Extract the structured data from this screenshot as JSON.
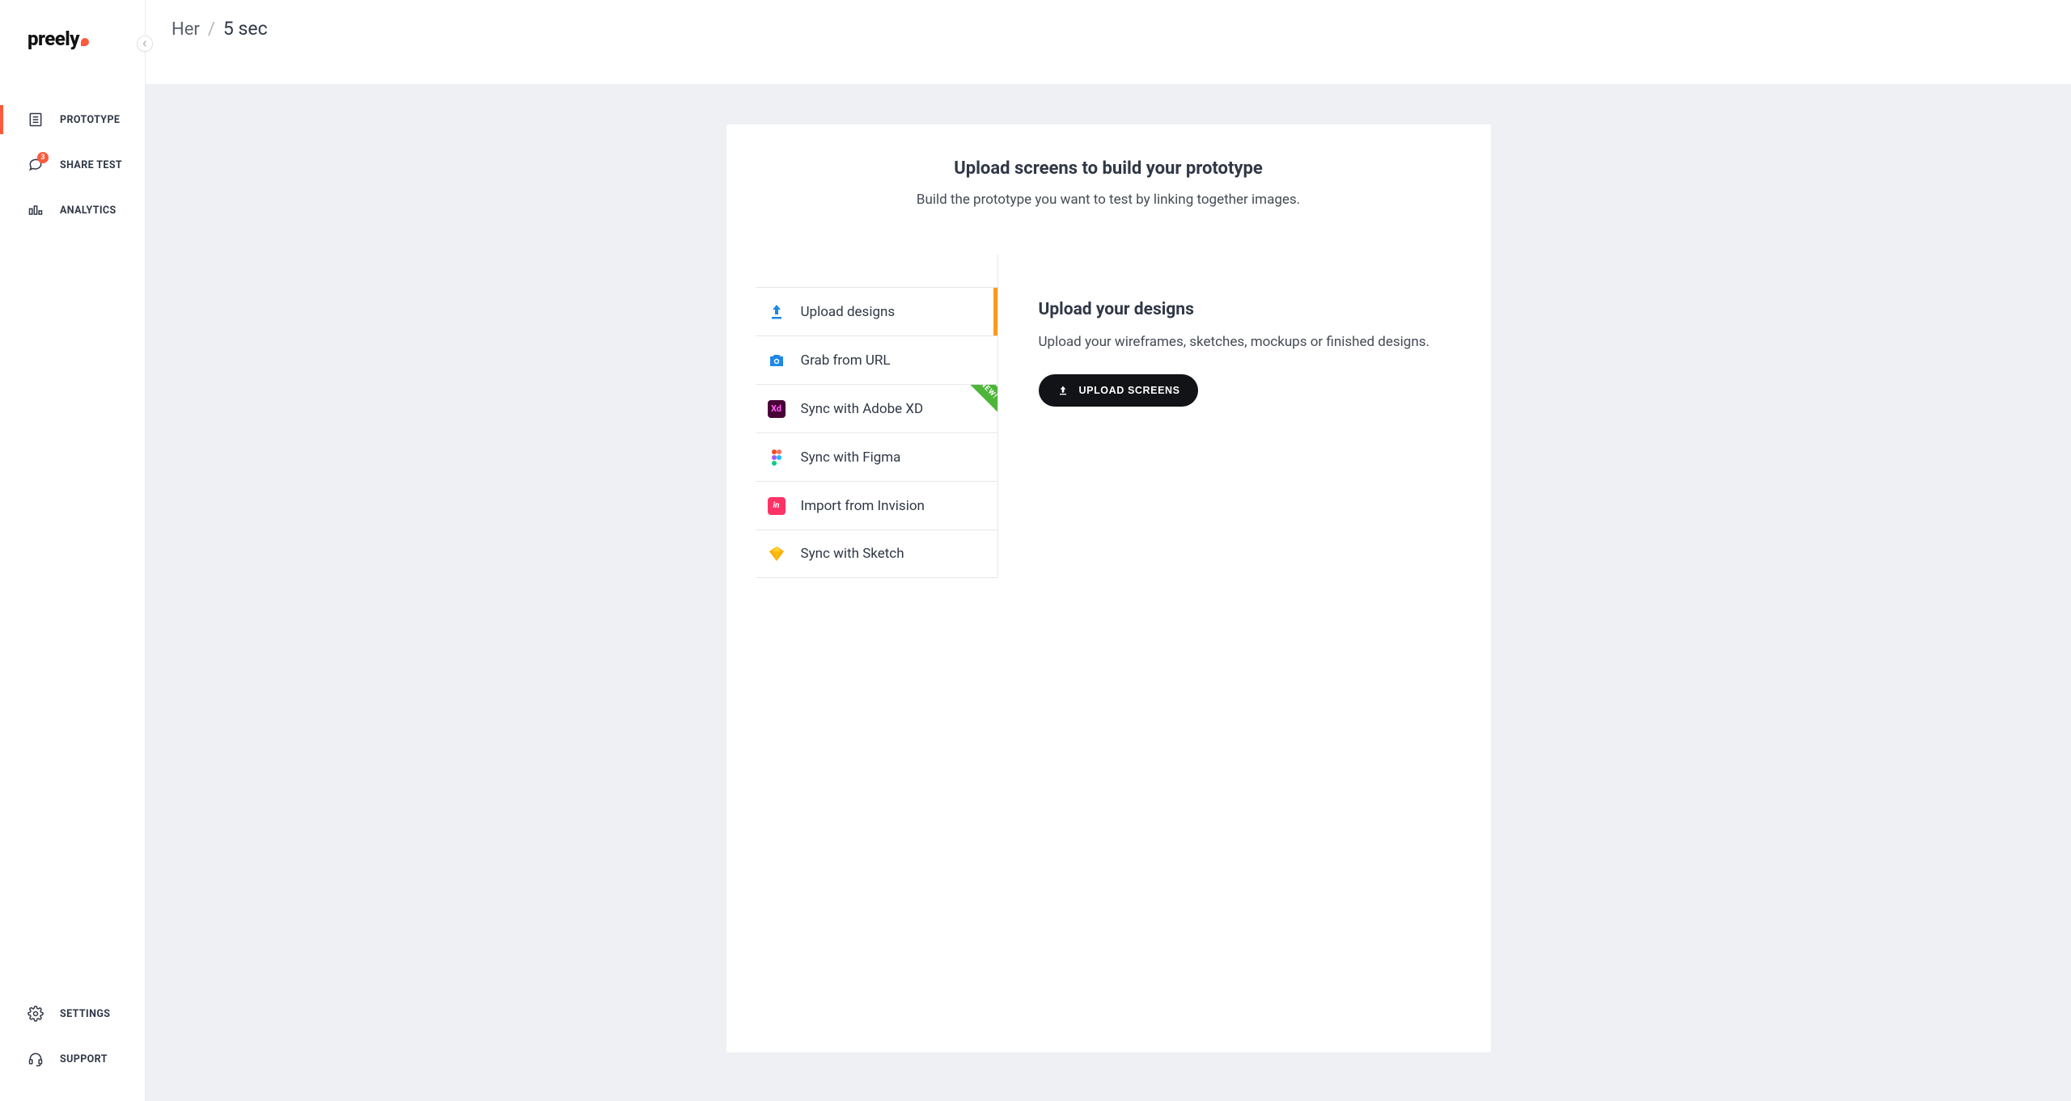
{
  "brand": {
    "name": "preely"
  },
  "sidebar": {
    "collapse_tooltip": "Collapse",
    "items": [
      {
        "id": "prototype",
        "label": "PROTOTYPE"
      },
      {
        "id": "share-test",
        "label": "SHARE TEST",
        "badge": "3"
      },
      {
        "id": "analytics",
        "label": "ANALYTICS"
      }
    ],
    "footer": [
      {
        "id": "settings",
        "label": "SETTINGS"
      },
      {
        "id": "support",
        "label": "SUPPORT"
      }
    ]
  },
  "breadcrumb": {
    "parent": "Her",
    "separator": "/",
    "current": "5 sec"
  },
  "hero": {
    "title": "Upload screens to build your prototype",
    "subtitle": "Build the prototype you want to test by linking together images."
  },
  "options": [
    {
      "id": "upload-designs",
      "label": "Upload designs",
      "icon": "upload-icon",
      "active": true
    },
    {
      "id": "grab-url",
      "label": "Grab from URL",
      "icon": "camera-icon"
    },
    {
      "id": "sync-xd",
      "label": "Sync with Adobe XD",
      "icon": "adobe-xd-icon",
      "ribbon": "NEW!"
    },
    {
      "id": "sync-figma",
      "label": "Sync with Figma",
      "icon": "figma-icon"
    },
    {
      "id": "import-invision",
      "label": "Import from Invision",
      "icon": "invision-icon"
    },
    {
      "id": "sync-sketch",
      "label": "Sync with Sketch",
      "icon": "sketch-icon"
    }
  ],
  "detail": {
    "title": "Upload your designs",
    "description": "Upload your wireframes, sketches, mockups or finished designs.",
    "button_label": "UPLOAD SCREENS"
  }
}
